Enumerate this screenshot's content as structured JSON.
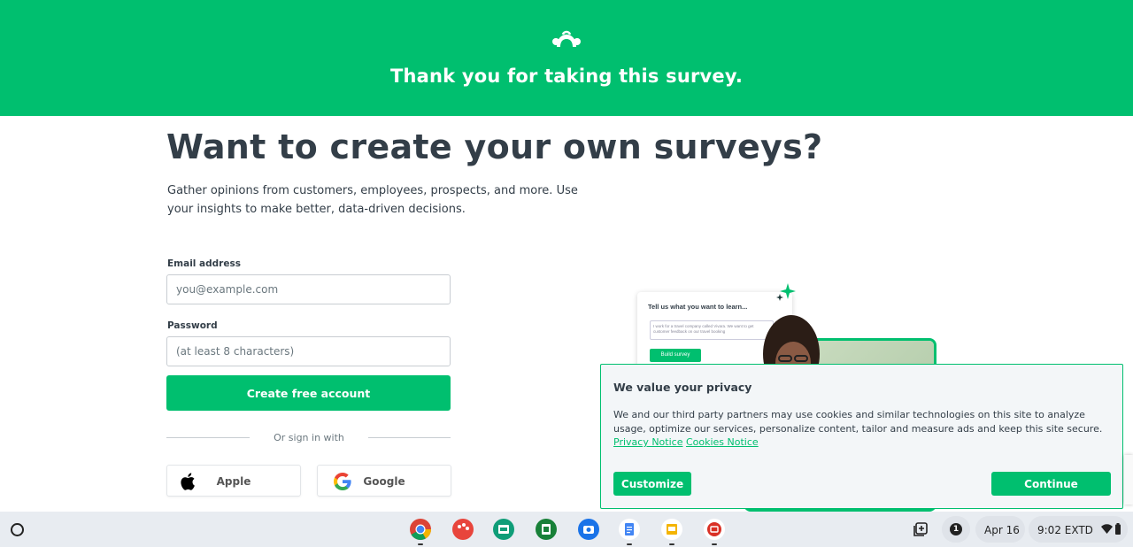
{
  "banner": {
    "title": "Thank you for taking this survey.",
    "logo_icon": "surveymonkey-logo-icon",
    "color": "#00bf6f"
  },
  "main": {
    "headline": "Want to create your own surveys?",
    "subtext": "Gather opinions from customers, employees, prospects, and more. Use your insights to make better, data-driven decisions."
  },
  "form": {
    "email_label": "Email address",
    "email_placeholder": "you@example.com",
    "password_label": "Password",
    "password_placeholder": "(at least 8 characters)",
    "submit_label": "Create free account",
    "divider_text": "Or sign in with",
    "sso": [
      {
        "label": "Apple",
        "icon": "apple-icon"
      },
      {
        "label": "Google",
        "icon": "google-icon"
      }
    ]
  },
  "illustration": {
    "card_title": "Tell us what you want to learn...",
    "card_text": "I work for a travel company called Vivara. We want to get customer feedback on our travel booking",
    "card_button": "Build survey"
  },
  "privacy": {
    "title": "We value your privacy",
    "body": "We and our third party partners may use cookies and similar technologies on this site to analyze usage, optimize our services, personalize content, tailor and measure ads and keep this site secure.",
    "link1": "Privacy Notice",
    "link2": "Cookies Notice",
    "customize_label": "Customize",
    "continue_label": "Continue"
  },
  "taskbar": {
    "apps": [
      "chrome-icon",
      "paint-icon",
      "classroom-icon",
      "sheets-icon",
      "camera-icon",
      "docs-icon",
      "slides-icon",
      "screencast-icon"
    ],
    "notification_count": "1",
    "date": "Apr 16",
    "time": "9:02 EXTD"
  }
}
